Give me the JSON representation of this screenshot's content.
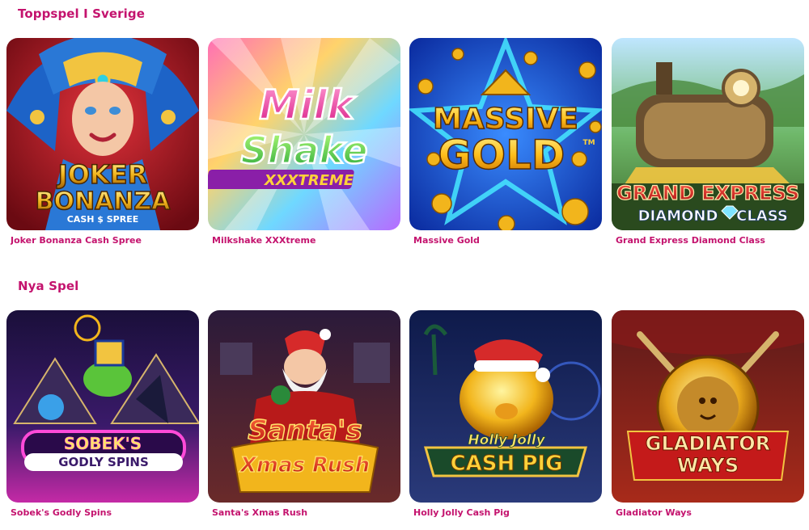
{
  "sections": [
    {
      "title": "Toppspel I Sverige",
      "games": [
        {
          "title": "Joker Bonanza Cash Spree",
          "logo_lines": [
            "JOKER",
            "BONANZA",
            "CASH $ SPREE"
          ]
        },
        {
          "title": "Milkshake XXXtreme",
          "logo_lines": [
            "Milk",
            "Shake",
            "XXXTREME"
          ]
        },
        {
          "title": "Massive Gold",
          "logo_lines": [
            "MASSIVE",
            "GOLD",
            "TM"
          ]
        },
        {
          "title": "Grand Express Diamond Class",
          "logo_lines": [
            "GRAND EXPRESS",
            "DIAMOND",
            "CLASS"
          ]
        }
      ]
    },
    {
      "title": "Nya Spel",
      "games": [
        {
          "title": "Sobek's Godly Spins",
          "logo_lines": [
            "SOBEK'S",
            "GODLY SPINS"
          ]
        },
        {
          "title": "Santa's Xmas Rush",
          "logo_lines": [
            "Santa's",
            "Xmas Rush"
          ]
        },
        {
          "title": "Holly Jolly Cash Pig",
          "logo_lines": [
            "Holly Jolly",
            "CASH PIG"
          ]
        },
        {
          "title": "Gladiator Ways",
          "logo_lines": [
            "GLADIATOR",
            "WAYS"
          ]
        }
      ]
    }
  ],
  "colors": {
    "brand_pink": "#c4136e",
    "background": "#ffffff"
  }
}
